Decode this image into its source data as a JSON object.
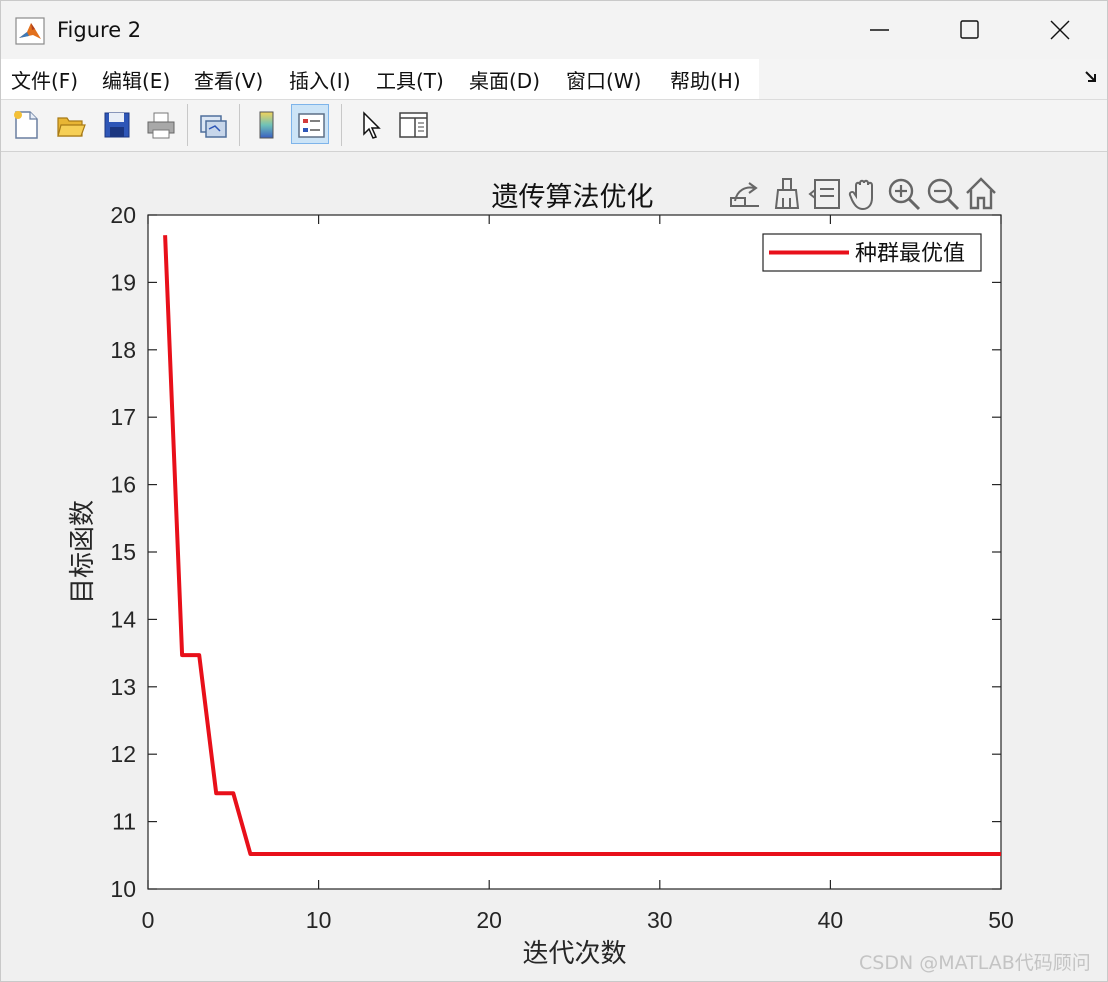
{
  "window": {
    "title": "Figure 2",
    "controls": [
      "minimize-icon",
      "maximize-icon",
      "close-icon"
    ]
  },
  "menubar": {
    "items": [
      {
        "label": "文件(F)"
      },
      {
        "label": "编辑(E)"
      },
      {
        "label": "查看(V)"
      },
      {
        "label": "插入(I)"
      },
      {
        "label": "工具(T)"
      },
      {
        "label": "桌面(D)"
      },
      {
        "label": "窗口(W)"
      },
      {
        "label": "帮助(H)"
      }
    ]
  },
  "toolbar": {
    "buttons": [
      "new-figure-icon",
      "open-file-icon",
      "save-icon",
      "print-icon",
      "link-plot-icon",
      "colorbar-icon",
      "legend-icon",
      "pointer-icon",
      "property-inspector-icon"
    ],
    "active": "legend-icon"
  },
  "axes_toolbar": {
    "buttons": [
      "export-icon",
      "brush-icon",
      "data-tips-icon",
      "pan-icon",
      "zoom-in-icon",
      "zoom-out-icon",
      "home-icon"
    ]
  },
  "chart_data": {
    "type": "line",
    "title": "遗传算法优化",
    "xlabel": "迭代次数",
    "ylabel": "目标函数",
    "xlim": [
      0,
      50
    ],
    "ylim": [
      10,
      20
    ],
    "xticks": [
      0,
      10,
      20,
      30,
      40,
      50
    ],
    "yticks": [
      10,
      11,
      12,
      13,
      14,
      15,
      16,
      17,
      18,
      19,
      20
    ],
    "grid": false,
    "legend_position": "top-right",
    "series": [
      {
        "name": "种群最优值",
        "color": "#e8101a",
        "x": [
          1,
          2,
          3,
          4,
          5,
          6,
          7,
          8,
          9,
          10,
          11,
          12,
          13,
          14,
          15,
          16,
          17,
          18,
          19,
          20,
          21,
          22,
          23,
          24,
          25,
          26,
          27,
          28,
          29,
          30,
          31,
          32,
          33,
          34,
          35,
          36,
          37,
          38,
          39,
          40,
          41,
          42,
          43,
          44,
          45,
          46,
          47,
          48,
          49,
          50
        ],
        "y": [
          19.7,
          13.47,
          13.47,
          11.42,
          11.42,
          10.52,
          10.52,
          10.52,
          10.52,
          10.52,
          10.52,
          10.52,
          10.52,
          10.52,
          10.52,
          10.52,
          10.52,
          10.52,
          10.52,
          10.52,
          10.52,
          10.52,
          10.52,
          10.52,
          10.52,
          10.52,
          10.52,
          10.52,
          10.52,
          10.52,
          10.52,
          10.52,
          10.52,
          10.52,
          10.52,
          10.52,
          10.52,
          10.52,
          10.52,
          10.52,
          10.52,
          10.52,
          10.52,
          10.52,
          10.52,
          10.52,
          10.52,
          10.52,
          10.52,
          10.52
        ]
      }
    ]
  },
  "watermark": "CSDN @MATLAB代码顾问"
}
